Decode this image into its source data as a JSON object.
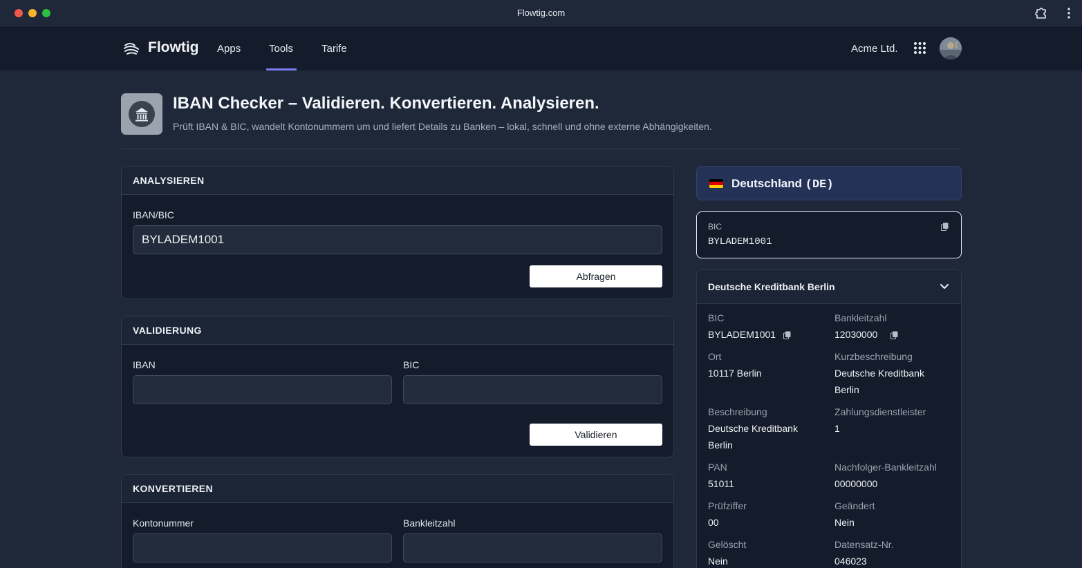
{
  "window": {
    "title": "Flowtig.com"
  },
  "nav": {
    "brand": "Flowtig",
    "items": [
      {
        "label": "Apps"
      },
      {
        "label": "Tools"
      },
      {
        "label": "Tarife"
      }
    ],
    "active": "Tools",
    "company": "Acme Ltd."
  },
  "page": {
    "title": "IBAN Checker – Validieren. Konvertieren. Analysieren.",
    "subtitle": "Prüft IBAN & BIC, wandelt Kontonummern um und liefert Details zu Banken – lokal, schnell und ohne externe Abhängigkeiten."
  },
  "analyze": {
    "heading": "ANALYSIEREN",
    "field_label": "IBAN/BIC",
    "field_value": "BYLADEM1001",
    "button": "Abfragen"
  },
  "validate": {
    "heading": "VALIDIERUNG",
    "iban_label": "IBAN",
    "iban_value": "",
    "bic_label": "BIC",
    "bic_value": "",
    "button": "Validieren"
  },
  "convert": {
    "heading": "KONVERTIEREN",
    "account_label": "Kontonummer",
    "account_value": "",
    "blz_label": "Bankleitzahl",
    "blz_value": ""
  },
  "country": {
    "name": "Deutschland",
    "code": "(DE)",
    "flag_colors": [
      "#000000",
      "#dd0000",
      "#ffce00"
    ]
  },
  "bic_card": {
    "label": "BIC",
    "value": "BYLADEM1001"
  },
  "bank": {
    "name": "Deutsche Kreditbank Berlin",
    "bic_label": "BIC",
    "bic": "BYLADEM1001",
    "blz_label": "Bankleitzahl",
    "blz": "12030000",
    "ort_label": "Ort",
    "ort": "10117 Berlin",
    "kurz_label": "Kurzbeschreibung",
    "kurz": "Deutsche Kreditbank Berlin",
    "beschreibung_label": "Beschreibung",
    "beschreibung": "Deutsche Kreditbank Berlin",
    "zahlungsdienstleister_label": "Zahlungsdienstleister",
    "zahlungsdienstleister": "1",
    "pan_label": "PAN",
    "pan": "51011",
    "nachfolger_label": "Nachfolger-Bankleitzahl",
    "nachfolger": "00000000",
    "pruefziffer_label": "Prüfziffer",
    "pruefziffer": "00",
    "geaendert_label": "Geändert",
    "geaendert": "Nein",
    "geloescht_label": "Gelöscht",
    "geloescht": "Nein",
    "datensatz_label": "Datensatz-Nr.",
    "datensatz": "046023"
  },
  "colors": {
    "accent": "#7c7cf2",
    "nav_bg": "#141c2c",
    "page_bg": "#1e2839",
    "country_bg": "#243258"
  }
}
